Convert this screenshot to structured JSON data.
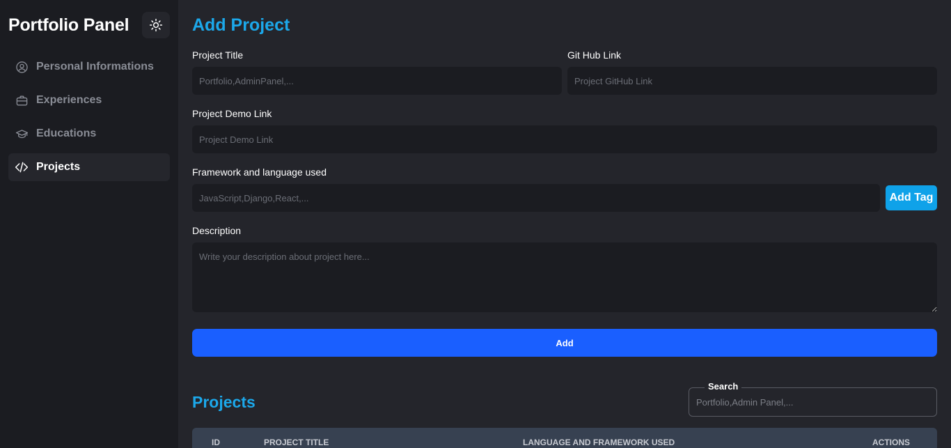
{
  "sidebar": {
    "brand": "Portfolio Panel",
    "theme_icon": "sun-icon",
    "items": [
      {
        "label": "Personal Informations",
        "icon": "user-circle-icon",
        "active": false
      },
      {
        "label": "Experiences",
        "icon": "briefcase-icon",
        "active": false
      },
      {
        "label": "Educations",
        "icon": "graduation-cap-icon",
        "active": false
      },
      {
        "label": "Projects",
        "icon": "code-icon",
        "active": true
      }
    ]
  },
  "form": {
    "title": "Add Project",
    "project_title_label": "Project Title",
    "project_title_placeholder": "Portfolio,AdminPanel,...",
    "github_label": "Git Hub Link",
    "github_placeholder": "Project GitHub Link",
    "demo_label": "Project Demo Link",
    "demo_placeholder": "Project Demo Link",
    "framework_label": "Framework and language used",
    "framework_placeholder": "JavaScript,Django,React,...",
    "add_tag_label": "Add Tag",
    "description_label": "Description",
    "description_placeholder": "Write your description about project here...",
    "submit_label": "Add"
  },
  "projects": {
    "title": "Projects",
    "search_label": "Search",
    "search_placeholder": "Portfolio,Admin Panel,...",
    "columns": [
      "ID",
      "PROJECT TITLE",
      "LANGUAGE AND FRAMEWORK USED",
      "ACTIONS"
    ]
  },
  "colors": {
    "accent": "#1ca8ea",
    "primary_button": "#1a5fff",
    "tag_button": "#0fa2e9",
    "sidebar_bg": "#1b1c21",
    "main_bg": "#24252b",
    "table_header_bg": "#374151"
  }
}
